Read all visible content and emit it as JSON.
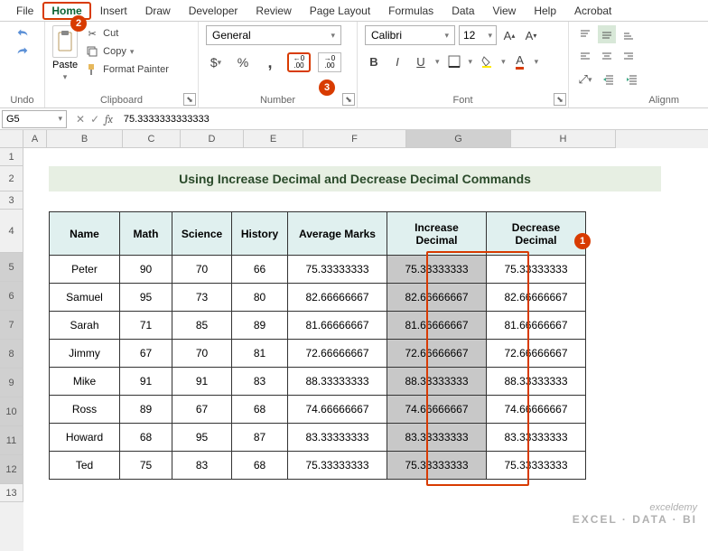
{
  "menu": {
    "file": "File",
    "home": "Home",
    "insert": "Insert",
    "draw": "Draw",
    "developer": "Developer",
    "review": "Review",
    "pagelayout": "Page Layout",
    "formulas": "Formulas",
    "data": "Data",
    "view": "View",
    "help": "Help",
    "acrobat": "Acrobat"
  },
  "ribbon": {
    "undo": "Undo",
    "clipboard": {
      "label": "Clipboard",
      "paste": "Paste",
      "cut": "Cut",
      "copy": "Copy",
      "fmt": "Format Painter"
    },
    "number": {
      "label": "Number",
      "format": "General"
    },
    "font": {
      "label": "Font",
      "name": "Calibri",
      "size": "12"
    },
    "align": {
      "label": "Alignm"
    }
  },
  "namebox": "G5",
  "formula": "75.3333333333333",
  "cols": {
    "A": "A",
    "B": "B",
    "C": "C",
    "D": "D",
    "E": "E",
    "F": "F",
    "G": "G",
    "H": "H"
  },
  "rows": [
    "1",
    "2",
    "3",
    "4",
    "5",
    "6",
    "7",
    "8",
    "9",
    "10",
    "11",
    "12",
    "13"
  ],
  "title": "Using Increase Decimal and Decrease Decimal Commands",
  "headers": {
    "name": "Name",
    "math": "Math",
    "science": "Science",
    "history": "History",
    "avg": "Average Marks",
    "inc": "Increase Decimal",
    "dec": "Decrease Decimal"
  },
  "data": [
    {
      "name": "Peter",
      "math": "90",
      "sci": "70",
      "hist": "66",
      "avg": "75.33333333",
      "inc": "75.33333333",
      "dec": "75.33333333"
    },
    {
      "name": "Samuel",
      "math": "95",
      "sci": "73",
      "hist": "80",
      "avg": "82.66666667",
      "inc": "82.66666667",
      "dec": "82.66666667"
    },
    {
      "name": "Sarah",
      "math": "71",
      "sci": "85",
      "hist": "89",
      "avg": "81.66666667",
      "inc": "81.66666667",
      "dec": "81.66666667"
    },
    {
      "name": "Jimmy",
      "math": "67",
      "sci": "70",
      "hist": "81",
      "avg": "72.66666667",
      "inc": "72.66666667",
      "dec": "72.66666667"
    },
    {
      "name": "Mike",
      "math": "91",
      "sci": "91",
      "hist": "83",
      "avg": "88.33333333",
      "inc": "88.33333333",
      "dec": "88.33333333"
    },
    {
      "name": "Ross",
      "math": "89",
      "sci": "67",
      "hist": "68",
      "avg": "74.66666667",
      "inc": "74.66666667",
      "dec": "74.66666667"
    },
    {
      "name": "Howard",
      "math": "68",
      "sci": "95",
      "hist": "87",
      "avg": "83.33333333",
      "inc": "83.33333333",
      "dec": "83.33333333"
    },
    {
      "name": "Ted",
      "math": "75",
      "sci": "83",
      "hist": "68",
      "avg": "75.33333333",
      "inc": "75.33333333",
      "dec": "75.33333333"
    }
  ],
  "watermark": {
    "brand": "exceldemy",
    "tag": "EXCEL · DATA · BI"
  },
  "colw": {
    "A": 26,
    "B": 84,
    "C": 64,
    "D": 70,
    "E": 66,
    "F": 114,
    "G": 116,
    "H": 116
  }
}
